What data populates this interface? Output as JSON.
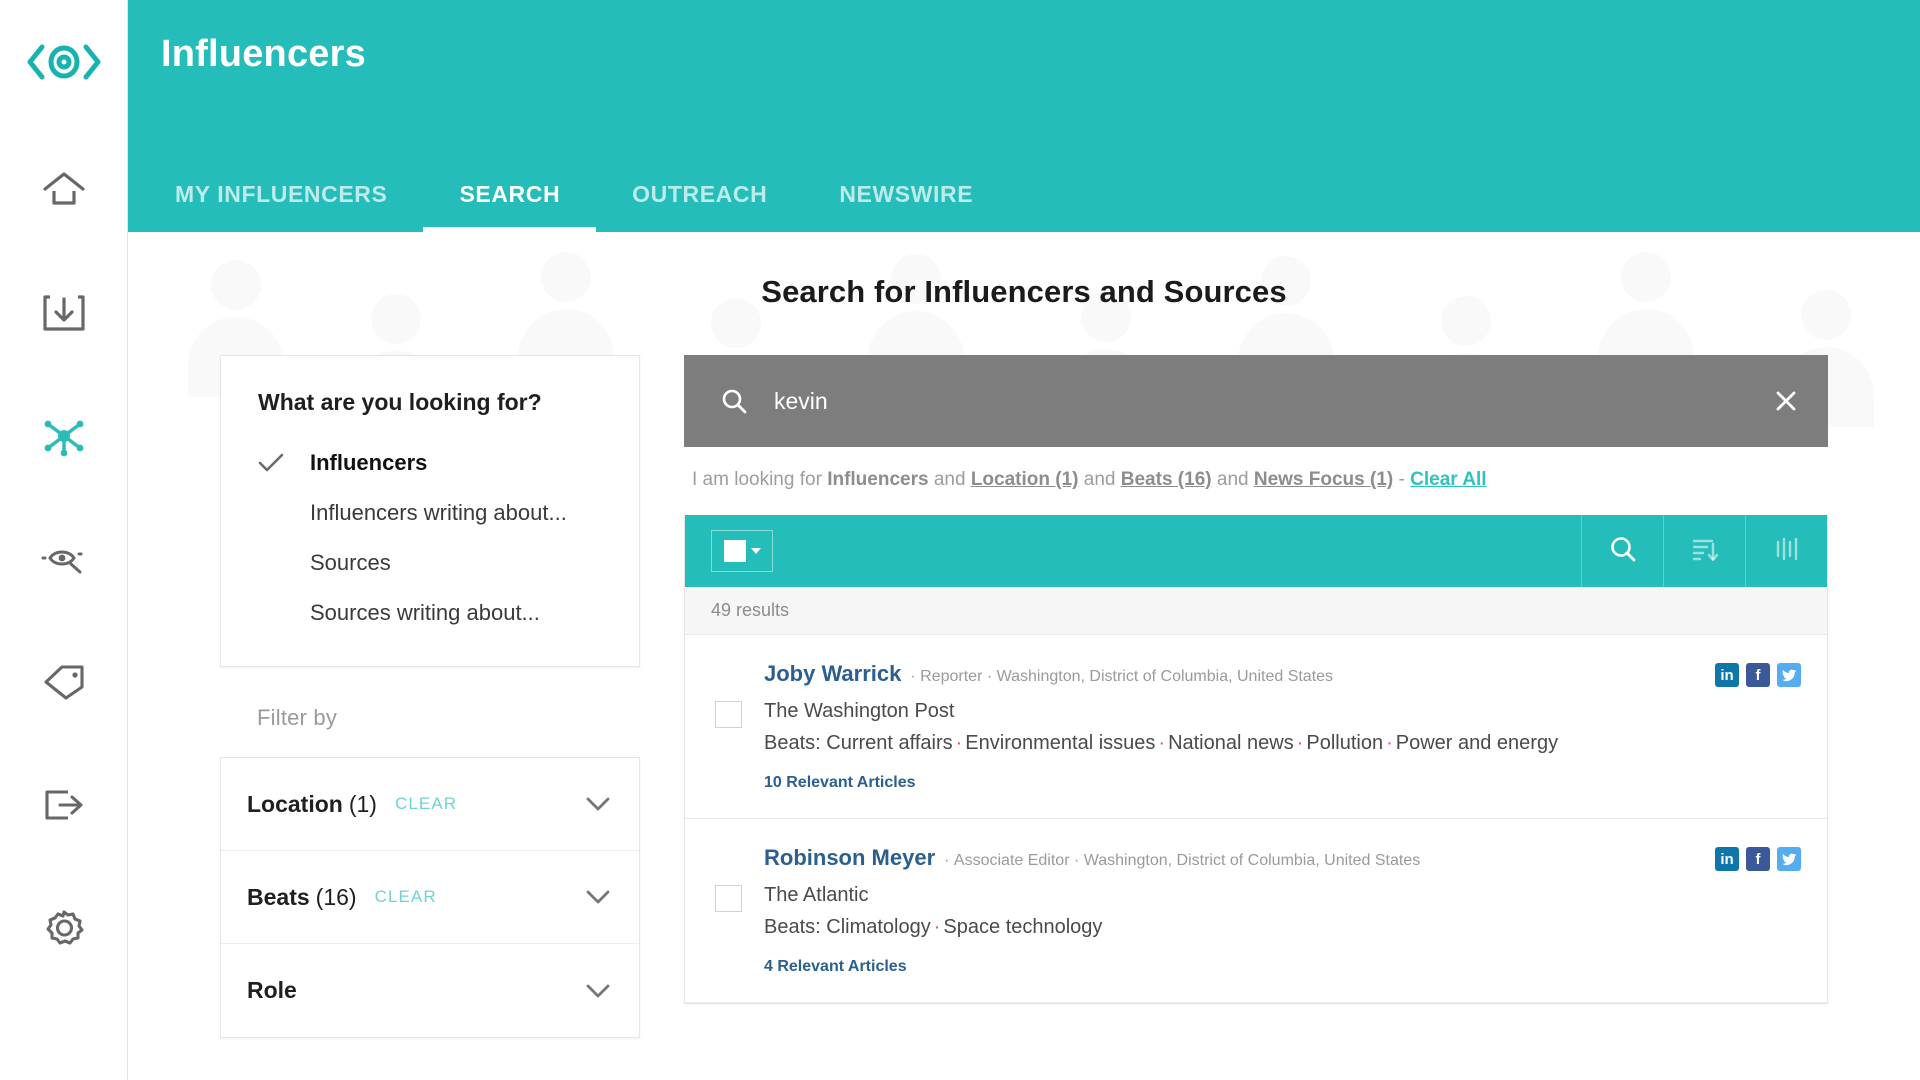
{
  "app": {
    "logo_icon": "eye-logo-icon",
    "accent_color": "#24bdb9",
    "title": "Influencers"
  },
  "sidebar": {
    "items": [
      {
        "name": "home",
        "icon": "home-icon",
        "active": false
      },
      {
        "name": "inbox",
        "icon": "inbox-download-icon",
        "active": false
      },
      {
        "name": "influencers",
        "icon": "network-nodes-icon",
        "active": true
      },
      {
        "name": "monitoring",
        "icon": "eye-search-icon",
        "active": false
      },
      {
        "name": "tags",
        "icon": "tag-icon",
        "active": false
      },
      {
        "name": "export",
        "icon": "export-arrow-icon",
        "active": false
      },
      {
        "name": "settings",
        "icon": "gear-icon",
        "active": false
      }
    ]
  },
  "header": {
    "title": "Influencers",
    "tabs": [
      {
        "label": "MY INFLUENCERS",
        "active": false
      },
      {
        "label": "SEARCH",
        "active": true
      },
      {
        "label": "OUTREACH",
        "active": false
      },
      {
        "label": "NEWSWIRE",
        "active": false
      }
    ]
  },
  "page": {
    "title": "Search for Influencers and Sources"
  },
  "looking_for": {
    "title": "What are you looking for?",
    "options": [
      {
        "label": "Influencers",
        "selected": true
      },
      {
        "label": "Influencers writing about...",
        "selected": false
      },
      {
        "label": "Sources",
        "selected": false
      },
      {
        "label": "Sources writing about...",
        "selected": false
      }
    ]
  },
  "filter_by": {
    "heading": "Filter by",
    "clear_label": "CLEAR",
    "rows": [
      {
        "name": "Location",
        "count": "(1)",
        "has_clear": true
      },
      {
        "name": "Beats",
        "count": "(16)",
        "has_clear": true
      },
      {
        "name": "Role",
        "count": "",
        "has_clear": false
      }
    ]
  },
  "search": {
    "value": "kevin",
    "placeholder": "Search",
    "icon": "search-icon",
    "clear_icon": "close-icon"
  },
  "query_summary": {
    "prefix": "I am looking for",
    "entity": "Influencers",
    "and": "and",
    "facets": [
      "Location (1)",
      "Beats (16)",
      "News Focus (1)"
    ],
    "separator": "-",
    "clear_all": "Clear All"
  },
  "results_toolbar": {
    "select_all_icon": "checkbox-dropdown",
    "buttons": [
      {
        "name": "search-results-icon",
        "label": "search"
      },
      {
        "name": "sort-icon",
        "label": "sort"
      },
      {
        "name": "columns-icon",
        "label": "columns"
      }
    ]
  },
  "results": {
    "count_label": "49 results",
    "rows": [
      {
        "name": "Joby Warrick",
        "role": "Reporter",
        "location": "Washington, District of Columbia, United States",
        "outlet": "The Washington Post",
        "beats_label": "Beats:",
        "beats": [
          "Current affairs",
          "Environmental issues",
          "National news",
          "Pollution",
          "Power and energy"
        ],
        "articles": "10 Relevant Articles",
        "socials": [
          "linkedin",
          "facebook",
          "twitter"
        ]
      },
      {
        "name": "Robinson Meyer",
        "role": "Associate Editor",
        "location": "Washington, District of Columbia, United States",
        "outlet": "The Atlantic",
        "beats_label": "Beats:",
        "beats": [
          "Climatology",
          "Space technology"
        ],
        "articles": "4 Relevant Articles",
        "socials": [
          "linkedin",
          "facebook",
          "twitter"
        ]
      }
    ]
  }
}
